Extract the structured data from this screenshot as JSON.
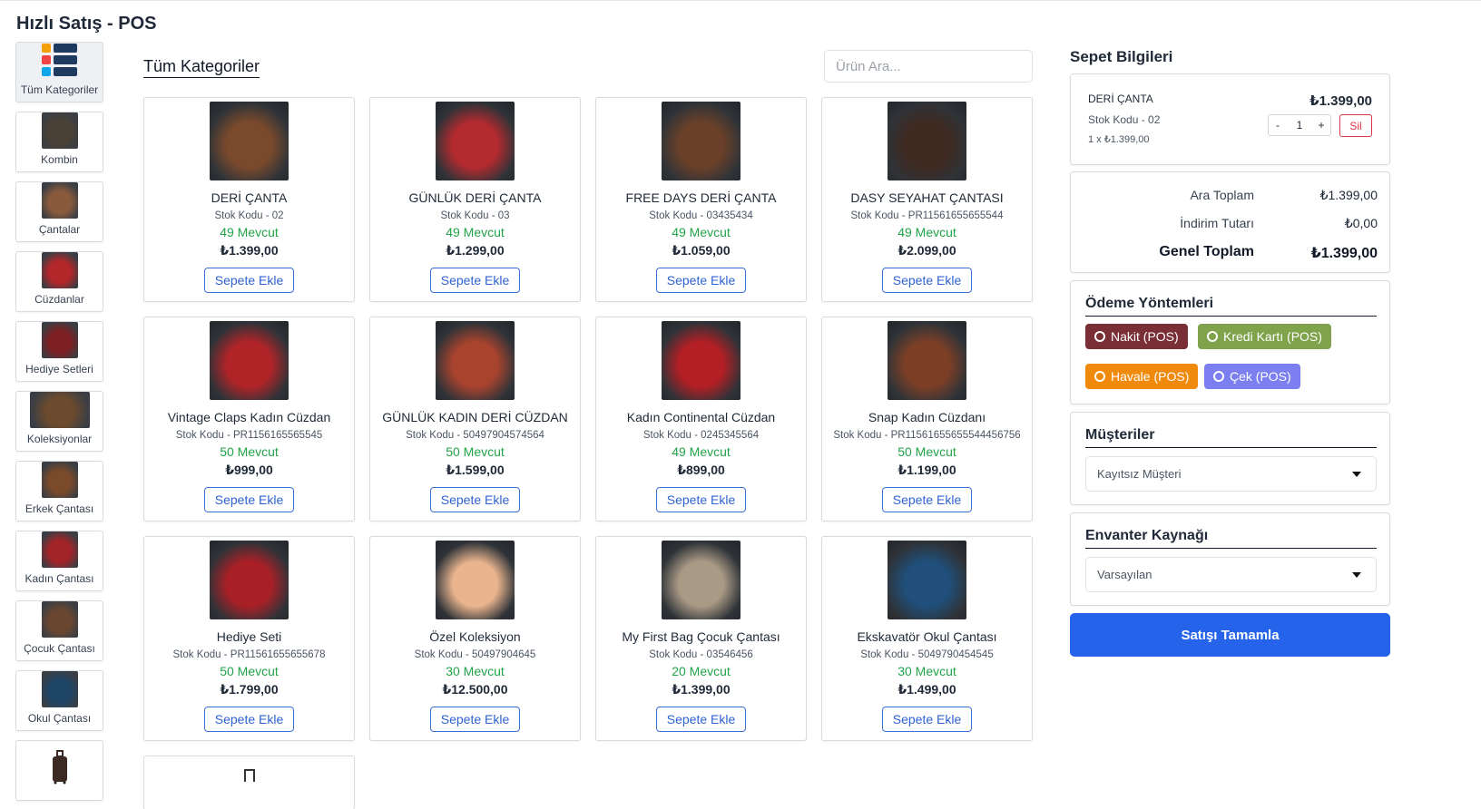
{
  "page_title": "Hızlı Satış - POS",
  "sidebar": {
    "categories": [
      {
        "label": "Tüm Kategoriler",
        "icon": "categories-grid-icon"
      },
      {
        "label": "Kombin",
        "thumb_color": "#4a4036"
      },
      {
        "label": "Çantalar",
        "thumb_color": "#8a5a3c"
      },
      {
        "label": "Cüzdanlar",
        "thumb_color": "#b3262a"
      },
      {
        "label": "Hediye Setleri",
        "thumb_color": "#7d1f22"
      },
      {
        "label": "Koleksiyonlar",
        "thumb_color": "#6b4a2e"
      },
      {
        "label": "Erkek Çantası",
        "thumb_color": "#7a4a2a"
      },
      {
        "label": "Kadın Çantası",
        "thumb_color": "#a32428"
      },
      {
        "label": "Çocuk Çantası",
        "thumb_color": "#6a4630"
      },
      {
        "label": "Okul Çantası",
        "thumb_color": "#1f4566"
      },
      {
        "label": "",
        "thumb_color": "#3a2a22"
      }
    ]
  },
  "main": {
    "title": "Tüm Kategoriler",
    "search_placeholder": "Ürün Ara...",
    "add_label": "Sepete Ekle",
    "products": [
      {
        "name": "DERİ ÇANTA",
        "code": "Stok Kodu - 02",
        "stock": "49 Mevcut",
        "price": "₺1.399,00",
        "img": "#7b4a2c"
      },
      {
        "name": "GÜNLÜK DERİ ÇANTA",
        "code": "Stok Kodu - 03",
        "stock": "49 Mevcut",
        "price": "₺1.299,00",
        "img": "#b52a2e"
      },
      {
        "name": "FREE DAYS DERİ ÇANTA",
        "code": "Stok Kodu - 03435434",
        "stock": "49 Mevcut",
        "price": "₺1.059,00",
        "img": "#6a4028"
      },
      {
        "name": "DASY SEYAHAT ÇANTASI",
        "code": "Stok Kodu - PR11561655655544",
        "stock": "49 Mevcut",
        "price": "₺2.099,00",
        "img": "#3f2a22"
      },
      {
        "name": "Vintage Claps Kadın Cüzdan",
        "code": "Stok Kodu - PR1156165565545",
        "stock": "50 Mevcut",
        "price": "₺999,00",
        "img": "#b02428"
      },
      {
        "name": "GÜNLÜK KADIN DERİ CÜZDAN",
        "code": "Stok Kodu - 50497904574564",
        "stock": "50 Mevcut",
        "price": "₺1.599,00",
        "img": "#a8432e"
      },
      {
        "name": "Kadın Continental Cüzdan",
        "code": "Stok Kodu - 0245345564",
        "stock": "49 Mevcut",
        "price": "₺899,00",
        "img": "#b21f24"
      },
      {
        "name": "Snap Kadın Cüzdanı",
        "code": "Stok Kodu - PR11561655655544456756",
        "stock": "50 Mevcut",
        "price": "₺1.199,00",
        "img": "#7c3f26"
      },
      {
        "name": "Hediye Seti",
        "code": "Stok Kodu - PR11561655655678",
        "stock": "50 Mevcut",
        "price": "₺1.799,00",
        "img": "#a82026"
      },
      {
        "name": "Özel Koleksiyon",
        "code": "Stok Kodu - 50497904645",
        "stock": "30 Mevcut",
        "price": "₺12.500,00",
        "img": "#e9b48e"
      },
      {
        "name": "My First Bag Çocuk Çantası",
        "code": "Stok Kodu - 03546456",
        "stock": "20 Mevcut",
        "price": "₺1.399,00",
        "img": "#a99a86"
      },
      {
        "name": "Ekskavatör Okul Çantası",
        "code": "Stok Kodu - 5049790454545",
        "stock": "30 Mevcut",
        "price": "₺1.499,00",
        "img": "#1f4f7a"
      }
    ]
  },
  "cart": {
    "title": "Sepet Bilgileri",
    "item": {
      "name": "DERİ ÇANTA",
      "code": "Stok Kodu - 02",
      "unit": "1 x ₺1.399,00",
      "total": "₺1.399,00",
      "qty_minus": "-",
      "qty": "1",
      "qty_plus": "+",
      "delete": "Sil"
    },
    "totals": {
      "subtotal_label": "Ara Toplam",
      "subtotal": "₺1.399,00",
      "discount_label": "İndirim Tutarı",
      "discount": "₺0,00",
      "grand_label": "Genel Toplam",
      "grand": "₺1.399,00"
    },
    "payment": {
      "title": "Ödeme Yöntemleri",
      "methods": [
        {
          "label": "Nakit (POS)",
          "color": "#7a2e36"
        },
        {
          "label": "Kredi Kartı (POS)",
          "color": "#7ea34a"
        },
        {
          "label": "Havale (POS)",
          "color": "#f08a0c"
        },
        {
          "label": "Çek (POS)",
          "color": "#7b7ff0"
        }
      ]
    },
    "customers": {
      "title": "Müşteriler",
      "selected": "Kayıtsız Müşteri"
    },
    "inventory": {
      "title": "Envanter Kaynağı",
      "selected": "Varsayılan"
    },
    "complete_label": "Satışı Tamamla"
  }
}
